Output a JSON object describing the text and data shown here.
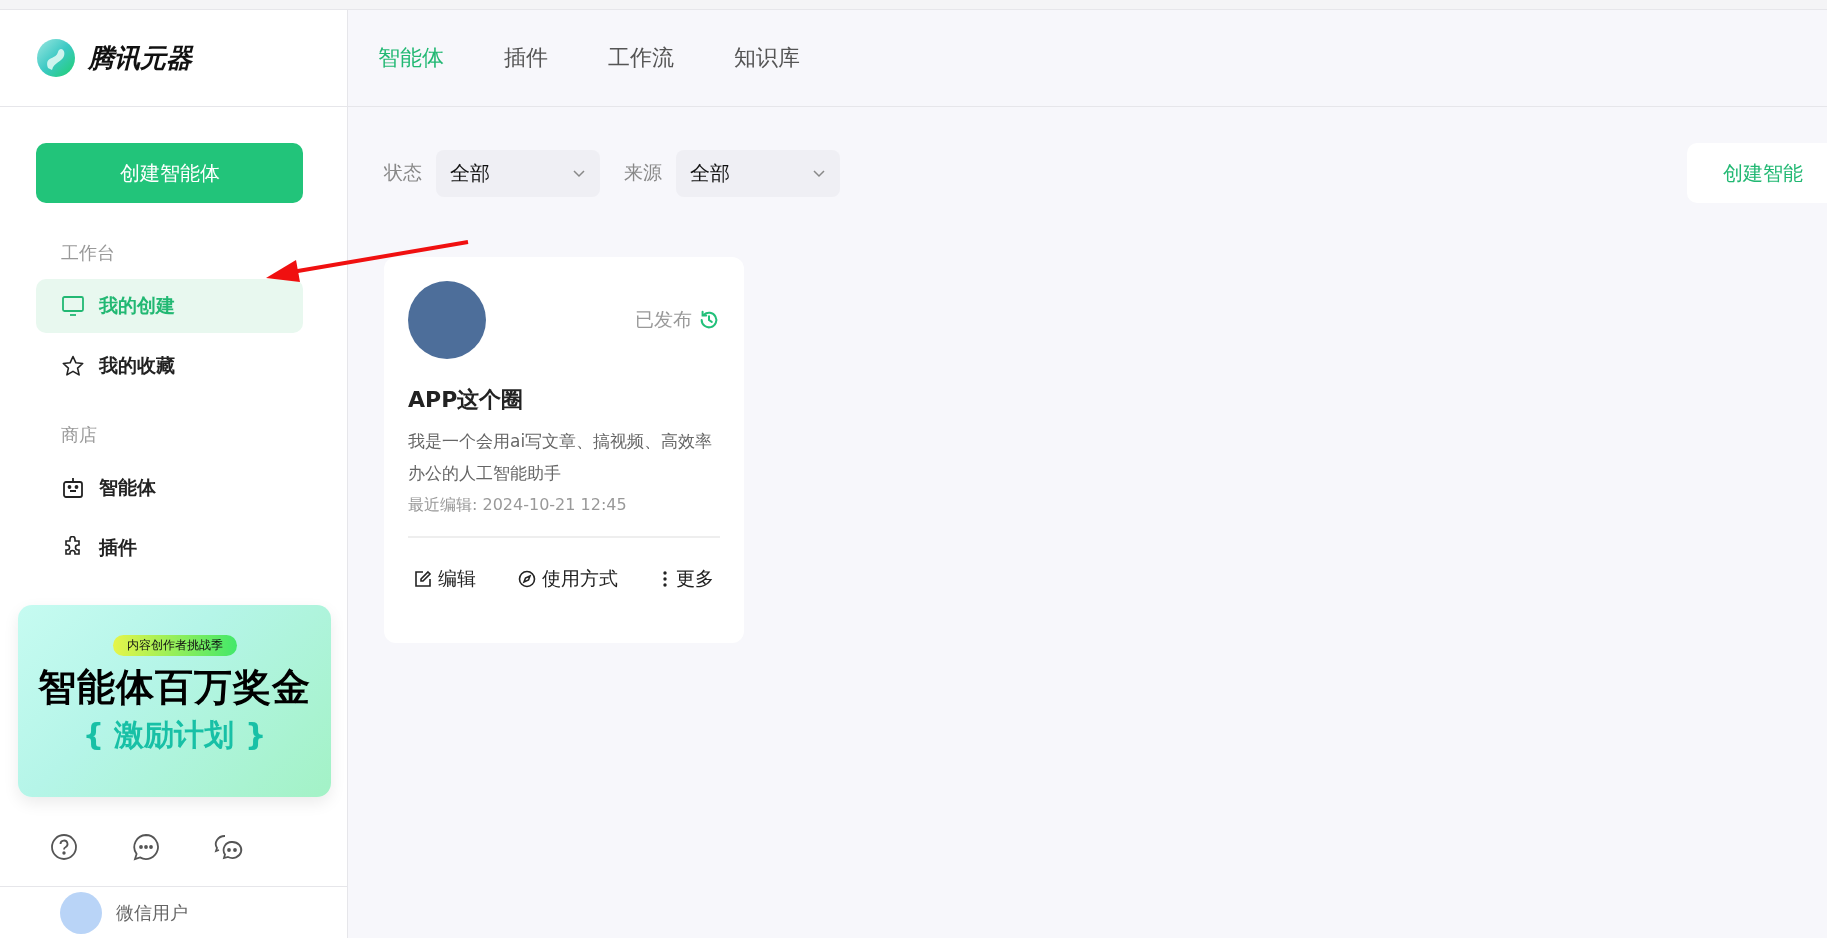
{
  "brand": {
    "name": "腾讯元器"
  },
  "sidebar": {
    "create_button": "创建智能体",
    "sections": [
      {
        "title": "工作台",
        "items": [
          {
            "label": "我的创建",
            "selected": true
          },
          {
            "label": "我的收藏",
            "selected": false
          }
        ]
      },
      {
        "title": "商店",
        "items": [
          {
            "label": "智能体",
            "selected": false
          },
          {
            "label": "插件",
            "selected": false
          }
        ]
      }
    ],
    "banner": {
      "tag": "内容创作者挑战季",
      "headline": "智能体百万奖金",
      "subline": "{ 激励计划 }"
    },
    "user": {
      "name": "微信用户"
    }
  },
  "tabs": [
    {
      "label": "智能体",
      "selected": true
    },
    {
      "label": "插件",
      "selected": false
    },
    {
      "label": "工作流",
      "selected": false
    },
    {
      "label": "知识库",
      "selected": false
    }
  ],
  "filters": [
    {
      "label": "状态",
      "value": "全部"
    },
    {
      "label": "来源",
      "value": "全部"
    }
  ],
  "create_button": "创建智能",
  "cards": [
    {
      "status": "已发布",
      "title": "APP这个圈",
      "description": "我是一个会用ai写文章、搞视频、高效率办公的人工智能助手",
      "edited": "最近编辑: 2024-10-21 12:45",
      "actions": [
        {
          "label": "编辑"
        },
        {
          "label": "使用方式"
        },
        {
          "label": "更多"
        }
      ]
    }
  ]
}
